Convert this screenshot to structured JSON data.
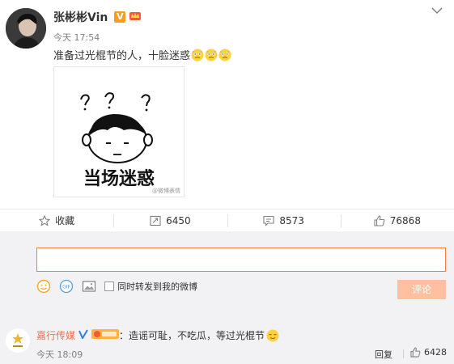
{
  "post": {
    "author": "张彬彬Vin",
    "verified_mark": "V",
    "time": "今天 17:54",
    "text": "准备过光棍节的人，十脸迷惑",
    "emoji_count": 3,
    "image": {
      "caption": "当场迷惑",
      "watermark": "@微博表情"
    }
  },
  "actions": {
    "favorite": "收藏",
    "repost": "6450",
    "comment": "8573",
    "like": "76868"
  },
  "composer": {
    "input_value": "",
    "repost_label": "同时转发到我的微博",
    "submit_label": "评论"
  },
  "comment": {
    "author": "嘉行传媒",
    "separator": "：",
    "text": "造谣可耻，不吃瓜，等过光棍节",
    "time": "今天 18:09",
    "reply_label": "回复",
    "likes": "6428"
  },
  "colors": {
    "accent": "#fa7d3c",
    "name_link": "#eb7350",
    "submit_disabled": "#ffc09f",
    "panel_bg": "#f2f2f5",
    "verified": "#f79d20"
  },
  "icons": [
    "chevron-down-icon",
    "star-icon",
    "repost-icon",
    "comment-icon",
    "thumbs-up-icon",
    "smiley-icon",
    "gif-icon",
    "image-icon"
  ]
}
